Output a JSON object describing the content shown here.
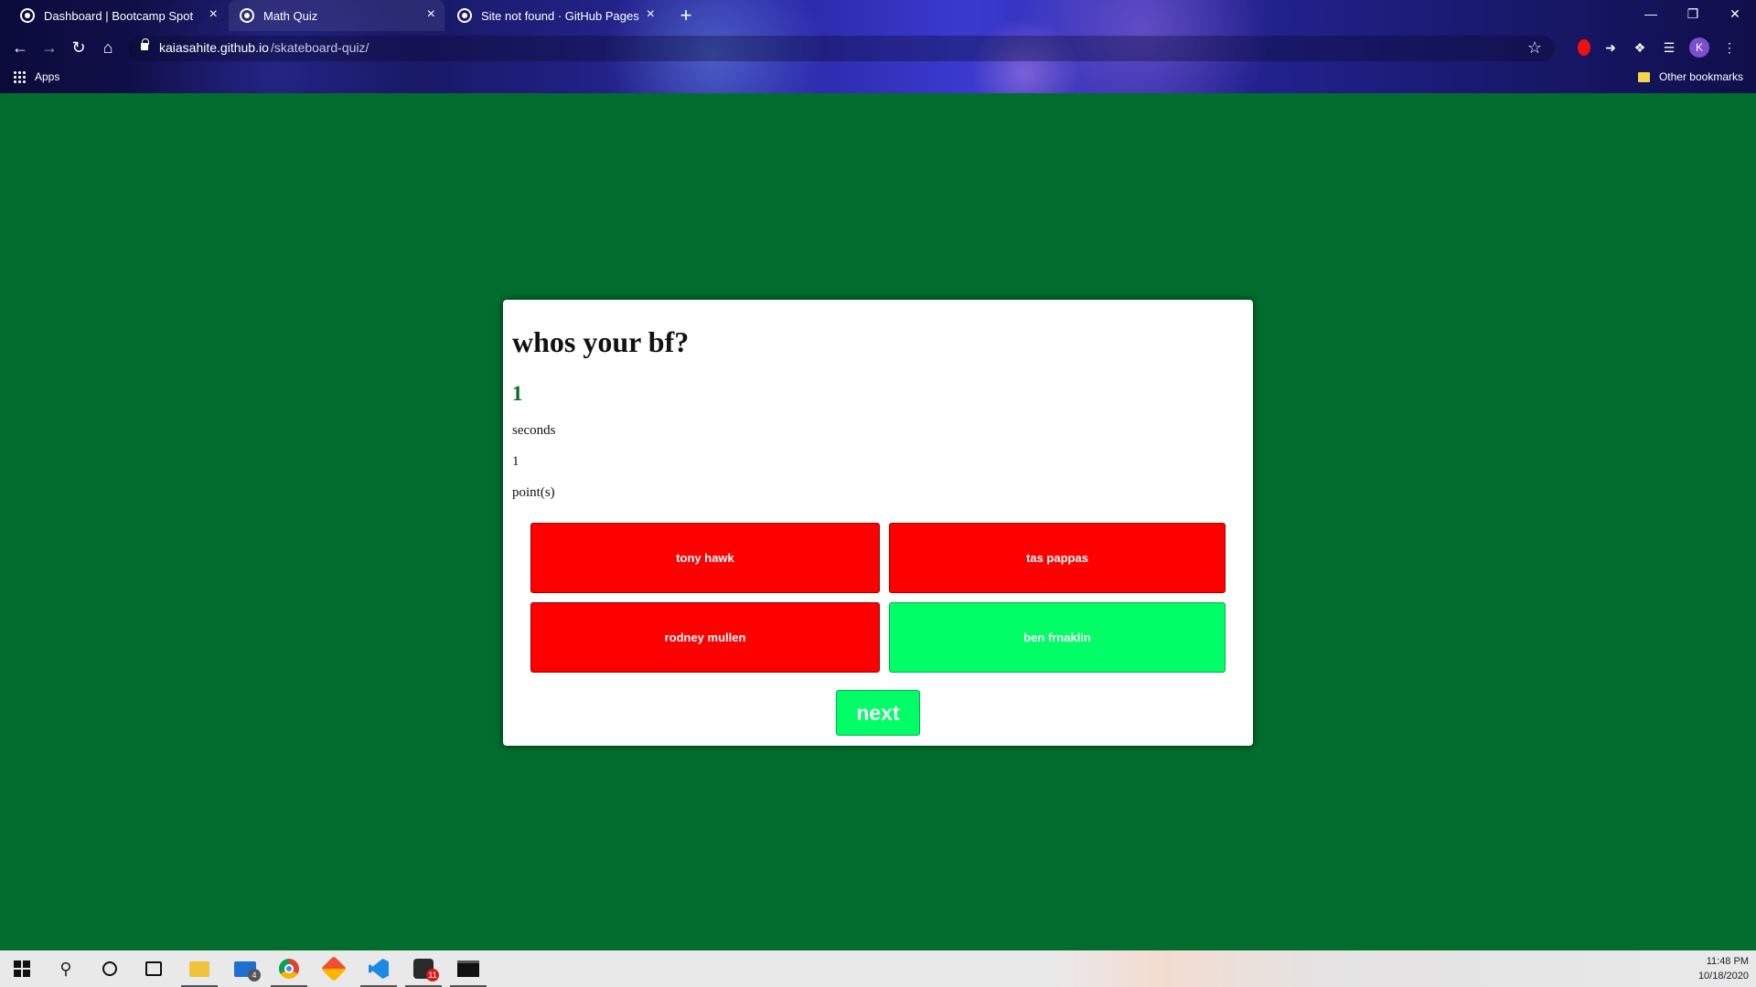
{
  "browser": {
    "tabs": [
      {
        "title": "Dashboard | Bootcamp Spot",
        "active": false
      },
      {
        "title": "Math Quiz",
        "active": true
      },
      {
        "title": "Site not found · GitHub Pages",
        "active": false
      }
    ],
    "new_tab_symbol": "+",
    "url_host": "kaiasahite.github.io",
    "url_path": "/skateboard-quiz/",
    "profile_initial": "K",
    "bookmarks": {
      "apps_label": "Apps",
      "other_label": "Other bookmarks"
    }
  },
  "quiz": {
    "question": "whos your bf?",
    "timer_value": "1",
    "timer_label": "seconds",
    "score_value": "1",
    "score_label": "point(s)",
    "answers": [
      {
        "label": "tony hawk",
        "state": "wrong"
      },
      {
        "label": "tas pappas",
        "state": "wrong"
      },
      {
        "label": "rodney mullen",
        "state": "wrong"
      },
      {
        "label": "ben frnaklin",
        "state": "correct"
      }
    ],
    "next_label": "next",
    "colors": {
      "background": "#026d2c",
      "wrong": "#ff0000",
      "correct": "#00ff66",
      "timer": "#036b27"
    }
  },
  "taskbar": {
    "mail_badge": "4",
    "github_badge": "11",
    "time": "11:48 PM",
    "date": "10/18/2020"
  }
}
